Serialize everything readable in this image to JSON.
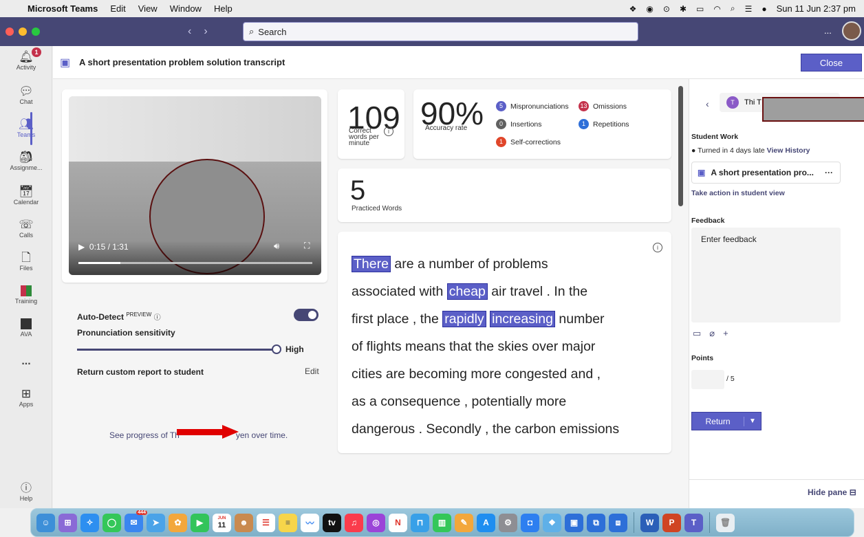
{
  "menubar": {
    "apple": "",
    "app": "Microsoft Teams",
    "items": [
      "Edit",
      "View",
      "Window",
      "Help"
    ],
    "datetime": "Sun 11 Jun  2:37 pm"
  },
  "titlebar": {
    "search_placeholder": "Search",
    "more": "..."
  },
  "rail": {
    "activity": "Activity",
    "activity_badge": "1",
    "chat": "Chat",
    "teams": "Teams",
    "assignments": "Assignme...",
    "calendar": "Calendar",
    "calls": "Calls",
    "files": "Files",
    "training": "Training",
    "ava": "AVA",
    "more": "...",
    "apps": "Apps",
    "help": "Help"
  },
  "header": {
    "title": "A short presentation problem solution transcript",
    "close": "Close"
  },
  "video": {
    "time": "0:15 / 1:31",
    "progress": 0.18
  },
  "settings": {
    "autodetect": "Auto-Detect",
    "preview": "PREVIEW",
    "sensitivity": "Pronunciation sensitivity",
    "sensitivity_value": "High",
    "custom_report": "Return custom report to student",
    "edit": "Edit",
    "progress_prefix": "See progress of Th",
    "progress_suffix": "yen over time."
  },
  "stats": {
    "wpm": "109",
    "wpm_label_1": "Correct",
    "wpm_label_2": "words per",
    "wpm_label_3": "minute",
    "accuracy": "90%",
    "accuracy_label": "Accuracy rate",
    "practiced": "5",
    "practiced_label": "Practiced Words",
    "legend": [
      {
        "count": "5",
        "label": "Mispronunciations",
        "color": "#5b5fc7"
      },
      {
        "count": "13",
        "label": "Omissions",
        "color": "#c4314b"
      },
      {
        "count": "0",
        "label": "Insertions",
        "color": "#616161"
      },
      {
        "count": "1",
        "label": "Repetitions",
        "color": "#2f6fd8"
      },
      {
        "count": "1",
        "label": "Self-corrections",
        "color": "#e0462a"
      }
    ]
  },
  "transcript": {
    "l1a": "There",
    "l1b": " are  a  number  of  problems",
    "l2a": "associated  with ",
    "l2b": "cheap",
    "l2c": "  air  travel . In  the",
    "l3a": "first  place , the ",
    "l3b": "rapidly",
    "l3c": "increasing",
    "l3d": "  number",
    "l4": "of  flights  means  that  the  skies  over  major",
    "l5": "cities  are  becoming  more  congested  and ,",
    "l6": "as  a  consequence , potentially  more",
    "l7": "dangerous . Secondly , the  carbon  emissions"
  },
  "pane": {
    "student_name": "Thi T",
    "student_initial": "T",
    "student_work": "Student Work",
    "turned_in": "Turned in 4 days late",
    "view_history": "View History",
    "work_title": "A short presentation pro...",
    "work_more": "···",
    "take_action": "Take action in student view",
    "feedback_label": "Feedback",
    "feedback_placeholder": "Enter feedback",
    "points_label": "Points",
    "points_total": "/ 5",
    "return": "Return",
    "hide_pane": "Hide pane"
  },
  "dock": {
    "calendar_month": "JUN",
    "calendar_day": "11",
    "mail_badge": "444"
  }
}
